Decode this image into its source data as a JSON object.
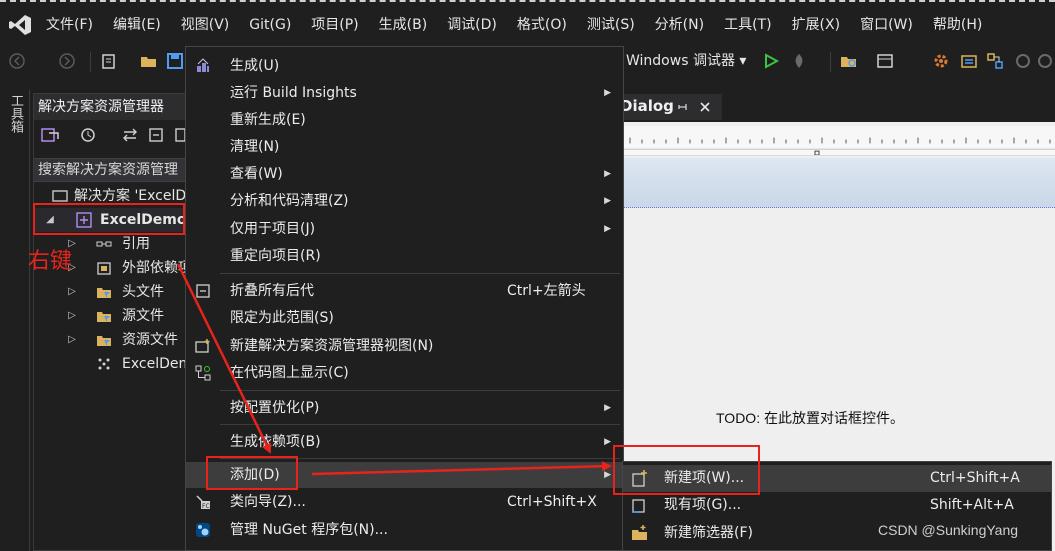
{
  "menubar": {
    "items": [
      "文件(F)",
      "编辑(E)",
      "视图(V)",
      "Git(G)",
      "项目(P)",
      "生成(B)",
      "调试(D)",
      "格式(O)",
      "测试(S)",
      "分析(N)",
      "工具(T)",
      "扩展(X)",
      "窗口(W)",
      "帮助(H)"
    ]
  },
  "toolbar": {
    "debug_target": "Windows 调试器 ▾"
  },
  "toolbox": {
    "label": "工具箱"
  },
  "solution_explorer": {
    "title": "解决方案资源管理器",
    "search_placeholder": "搜索解决方案资源管理",
    "tree": [
      {
        "label": "解决方案 'ExcelD",
        "arrow": "",
        "icon": "solution-icon"
      },
      {
        "label": "ExcelDemo",
        "arrow": "◢",
        "icon": "project-icon"
      },
      {
        "label": "引用",
        "arrow": "▷",
        "icon": "references-icon"
      },
      {
        "label": "外部依赖项",
        "arrow": "▷",
        "icon": "external-deps-icon"
      },
      {
        "label": "头文件",
        "arrow": "▷",
        "icon": "folder-filter-icon"
      },
      {
        "label": "源文件",
        "arrow": "▷",
        "icon": "folder-filter-icon"
      },
      {
        "label": "资源文件",
        "arrow": "▷",
        "icon": "folder-filter-icon"
      },
      {
        "label": "ExcelDemo",
        "arrow": "",
        "icon": "resource-file-icon"
      }
    ]
  },
  "designer": {
    "tab_label": "Dialog",
    "todo_text": "TODO: 在此放置对话框控件。"
  },
  "context_menu": {
    "items": [
      {
        "label": "生成(U)",
        "shortcut": "",
        "submenu": false
      },
      {
        "label": "运行 Build Insights",
        "shortcut": "",
        "submenu": true
      },
      {
        "label": "重新生成(E)",
        "shortcut": "",
        "submenu": false
      },
      {
        "label": "清理(N)",
        "shortcut": "",
        "submenu": false
      },
      {
        "label": "查看(W)",
        "shortcut": "",
        "submenu": true
      },
      {
        "label": "分析和代码清理(Z)",
        "shortcut": "",
        "submenu": true
      },
      {
        "label": "仅用于项目(J)",
        "shortcut": "",
        "submenu": true
      },
      {
        "label": "重定向项目(R)",
        "shortcut": "",
        "submenu": false
      },
      {
        "label": "折叠所有后代",
        "shortcut": "Ctrl+左箭头",
        "submenu": false
      },
      {
        "label": "限定为此范围(S)",
        "shortcut": "",
        "submenu": false
      },
      {
        "label": "新建解决方案资源管理器视图(N)",
        "shortcut": "",
        "submenu": false
      },
      {
        "label": "在代码图上显示(C)",
        "shortcut": "",
        "submenu": false
      },
      {
        "label": "按配置优化(P)",
        "shortcut": "",
        "submenu": true
      },
      {
        "label": "生成依赖项(B)",
        "shortcut": "",
        "submenu": true
      },
      {
        "label": "添加(D)",
        "shortcut": "",
        "submenu": true
      },
      {
        "label": "类向导(Z)...",
        "shortcut": "Ctrl+Shift+X",
        "submenu": false
      },
      {
        "label": "管理 NuGet 程序包(N)...",
        "shortcut": "",
        "submenu": false
      }
    ]
  },
  "submenu": {
    "items": [
      {
        "label": "新建项(W)...",
        "shortcut": "Ctrl+Shift+A"
      },
      {
        "label": "现有项(G)...",
        "shortcut": "Shift+Alt+A"
      },
      {
        "label": "新建筛选器(F)",
        "shortcut": ""
      }
    ]
  },
  "annotation": {
    "text": "右键",
    "color": "#e8231c"
  },
  "watermark": "CSDN @SunkingYang"
}
